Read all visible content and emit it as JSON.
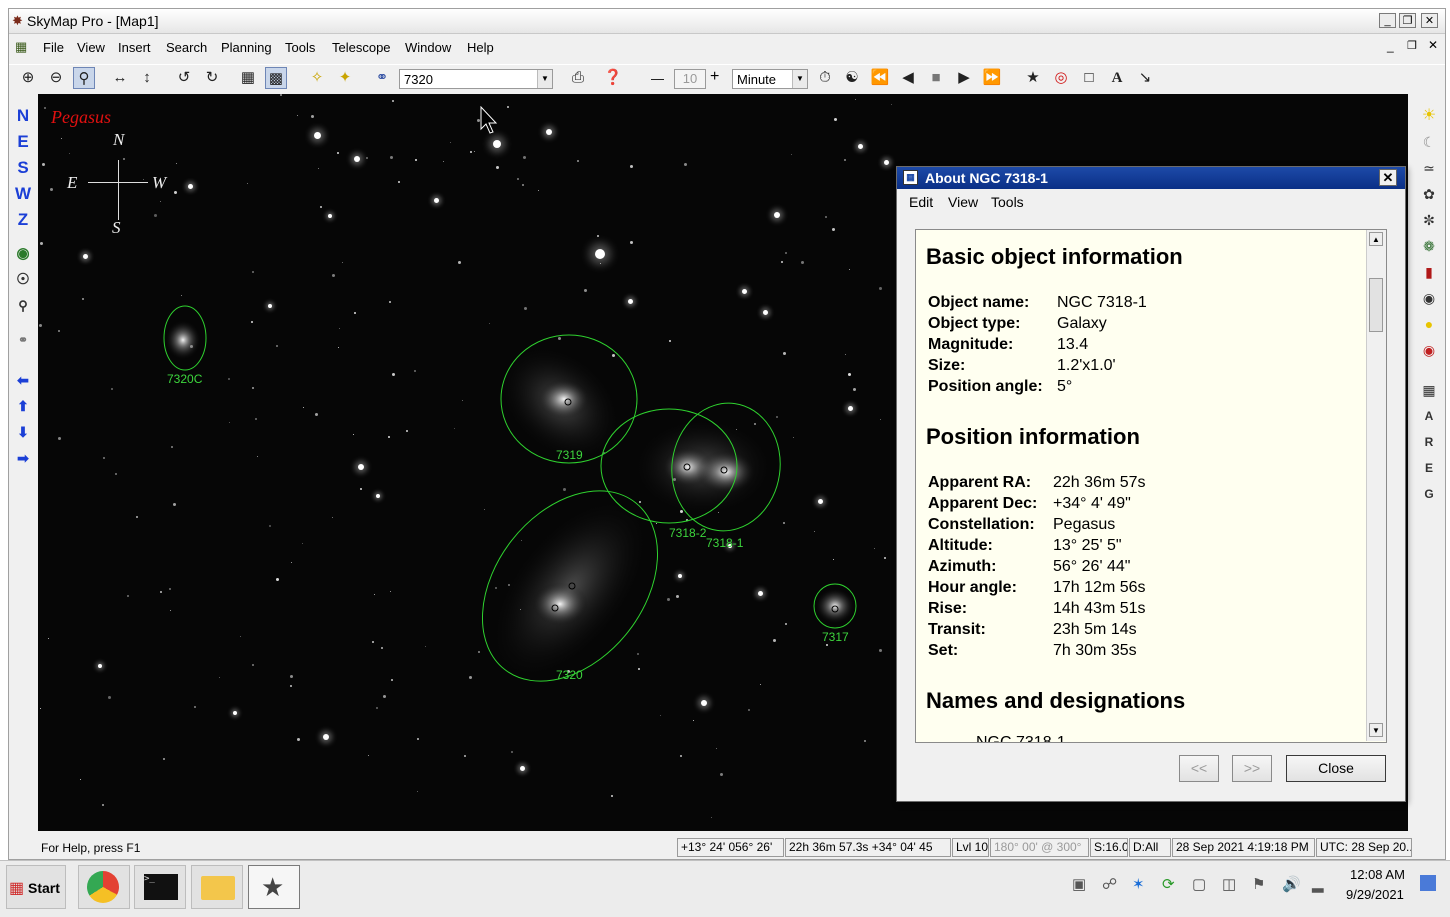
{
  "window": {
    "title": "SkyMap Pro - [Map1]"
  },
  "menu": [
    "File",
    "View",
    "Insert",
    "Search",
    "Planning",
    "Tools",
    "Telescope",
    "Window",
    "Help"
  ],
  "toolbar": {
    "search_value": "7320",
    "step_value": "10",
    "time_unit": "Minute",
    "minus_label": "—",
    "plus_label": "+"
  },
  "left_toolbar": [
    "N",
    "E",
    "S",
    "W",
    "Z"
  ],
  "right_toolbar": [
    "A",
    "R",
    "E",
    "G"
  ],
  "sky": {
    "constellation": "Pegasus",
    "compass": {
      "n": "N",
      "e": "E",
      "s": "S",
      "w": "W"
    },
    "labels": [
      {
        "name": "7320C",
        "color": "#3dd63d"
      },
      {
        "name": "7319",
        "color": "#3dd63d"
      },
      {
        "name": "7318-2",
        "color": "#3dd63d"
      },
      {
        "name": "7318-1",
        "color": "#3dd63d"
      },
      {
        "name": "7320",
        "color": "#3dd63d"
      },
      {
        "name": "7317",
        "color": "#3dd63d"
      }
    ]
  },
  "about": {
    "title": "About NGC 7318-1",
    "menu": [
      "Edit",
      "View",
      "Tools"
    ],
    "basic_heading": "Basic object information",
    "basic": [
      {
        "k": "Object name:",
        "v": "NGC 7318-1"
      },
      {
        "k": "Object type:",
        "v": "Galaxy"
      },
      {
        "k": "Magnitude:",
        "v": "13.4"
      },
      {
        "k": "Size:",
        "v": "1.2'x1.0'"
      },
      {
        "k": "Position angle:",
        "v": "5°"
      }
    ],
    "position_heading": "Position information",
    "position": [
      {
        "k": "Apparent RA:",
        "v": "22h 36m 57s"
      },
      {
        "k": "Apparent Dec:",
        "v": "+34° 4' 49\""
      },
      {
        "k": "Constellation:",
        "v": "Pegasus"
      },
      {
        "k": "Altitude:",
        "v": "13° 25' 5\""
      },
      {
        "k": "Azimuth:",
        "v": "56° 26' 44\""
      },
      {
        "k": "Hour angle:",
        "v": "17h 12m 56s"
      },
      {
        "k": "Rise:",
        "v": "14h 43m 51s"
      },
      {
        "k": "Transit:",
        "v": "23h 5m 14s"
      },
      {
        "k": "Set:",
        "v": "7h 30m 35s"
      }
    ],
    "names_heading": "Names and designations",
    "names_partial": "NGC 7318-1",
    "prev_label": "<<",
    "next_label": ">>",
    "close_label": "Close"
  },
  "status": {
    "help": "For Help, press F1",
    "altaz": "+13° 24'  056° 26'",
    "radec": "22h 36m 57.3s  +34° 04' 45",
    "level": "Lvl 10",
    "fov": "180° 00' @ 300°",
    "scale": "S:16.0",
    "d": "D:All",
    "local": "28 Sep 2021 4:19:18 PM",
    "utc": "UTC: 28 Sep 20..."
  },
  "taskbar": {
    "start": "Start",
    "time": "12:08 AM",
    "date": "9/29/2021"
  }
}
